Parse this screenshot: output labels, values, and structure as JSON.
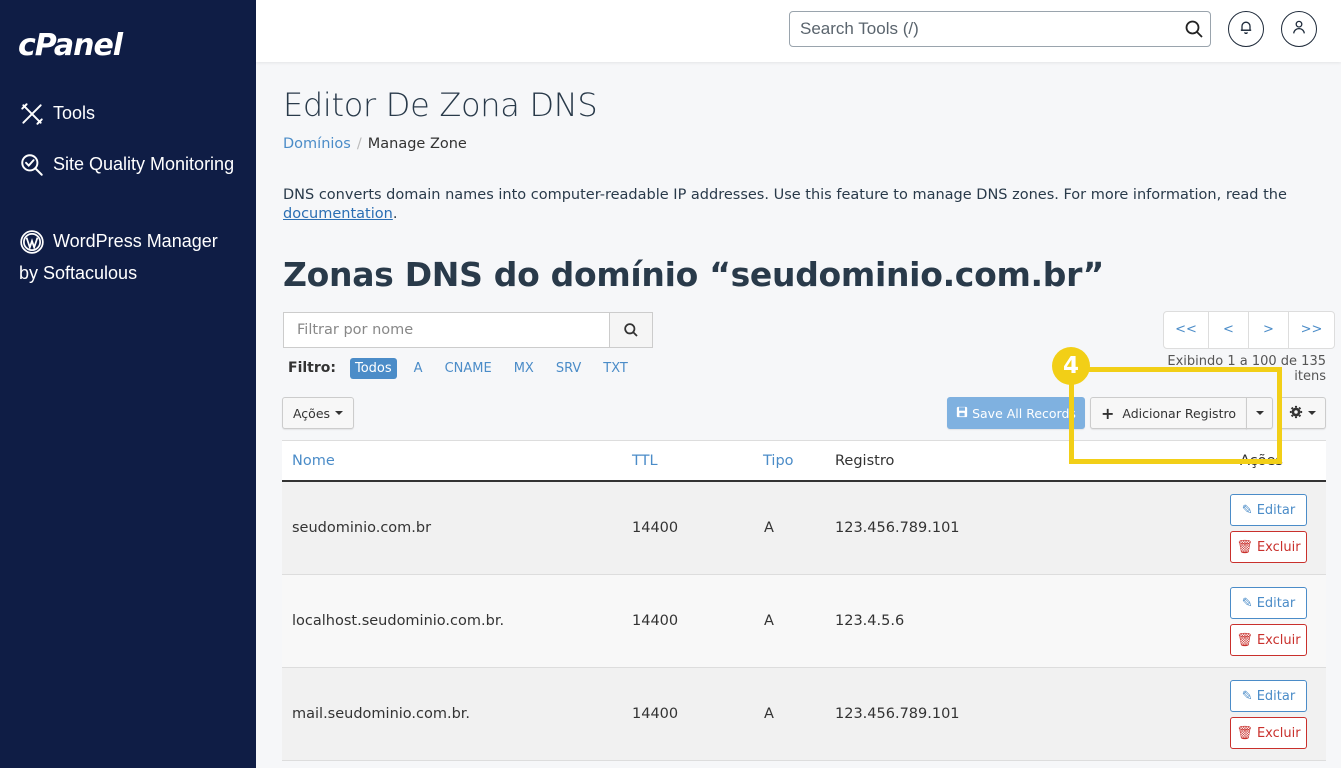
{
  "brand": {
    "logo": "cPanel"
  },
  "sidebar": {
    "items": [
      {
        "label": "Tools",
        "icon": "tools-icon"
      },
      {
        "label": "Site Quality Monitoring",
        "icon": "site-quality-icon"
      },
      {
        "label": "WordPress Manager by Softaculous",
        "icon": "wordpress-icon"
      }
    ]
  },
  "topbar": {
    "search_placeholder": "Search Tools (/)",
    "icons": [
      "search-icon",
      "bell-icon",
      "user-icon"
    ]
  },
  "page": {
    "title": "Editor De Zona DNS",
    "breadcrumb": {
      "link": "Domínios",
      "separator": "/",
      "current": "Manage Zone"
    },
    "description": "DNS converts domain names into computer-readable IP addresses. Use this feature to manage DNS zones. For more information, read the",
    "description_link": "documentation",
    "description_end": ".",
    "zones_title": "Zonas DNS do domínio “seudominio.com.br”"
  },
  "filter": {
    "placeholder": "Filtrar por nome",
    "label": "Filtro:",
    "chips": [
      "Todos",
      "A",
      "CNAME",
      "MX",
      "SRV",
      "TXT"
    ],
    "active": "Todos"
  },
  "pagination": {
    "buttons": [
      "<<",
      "<",
      ">",
      ">>"
    ],
    "showing": "Exibindo 1 a 100 de 135 itens"
  },
  "toolbar": {
    "actions_label": "Ações",
    "save_label": "Save All Records",
    "add_label": "Adicionar Registro"
  },
  "annotation": {
    "step": "4",
    "color": "#f2cf17"
  },
  "table": {
    "headers": {
      "name": "Nome",
      "ttl": "TTL",
      "type": "Tipo",
      "record": "Registro",
      "actions": "Ações"
    },
    "rows": [
      {
        "name": "seudominio.com.br",
        "ttl": "14400",
        "type": "A",
        "record": "123.456.789.101"
      },
      {
        "name": "localhost.seudominio.com.br.",
        "ttl": "14400",
        "type": "A",
        "record": "123.4.5.6"
      },
      {
        "name": "mail.seudominio.com.br.",
        "ttl": "14400",
        "type": "A",
        "record": "123.456.789.101"
      }
    ],
    "edit_label": "Editar",
    "delete_label": "Excluir"
  },
  "colors": {
    "sidebar": "#0f1d45",
    "link": "#4b8cc8",
    "danger": "#c9302c"
  }
}
